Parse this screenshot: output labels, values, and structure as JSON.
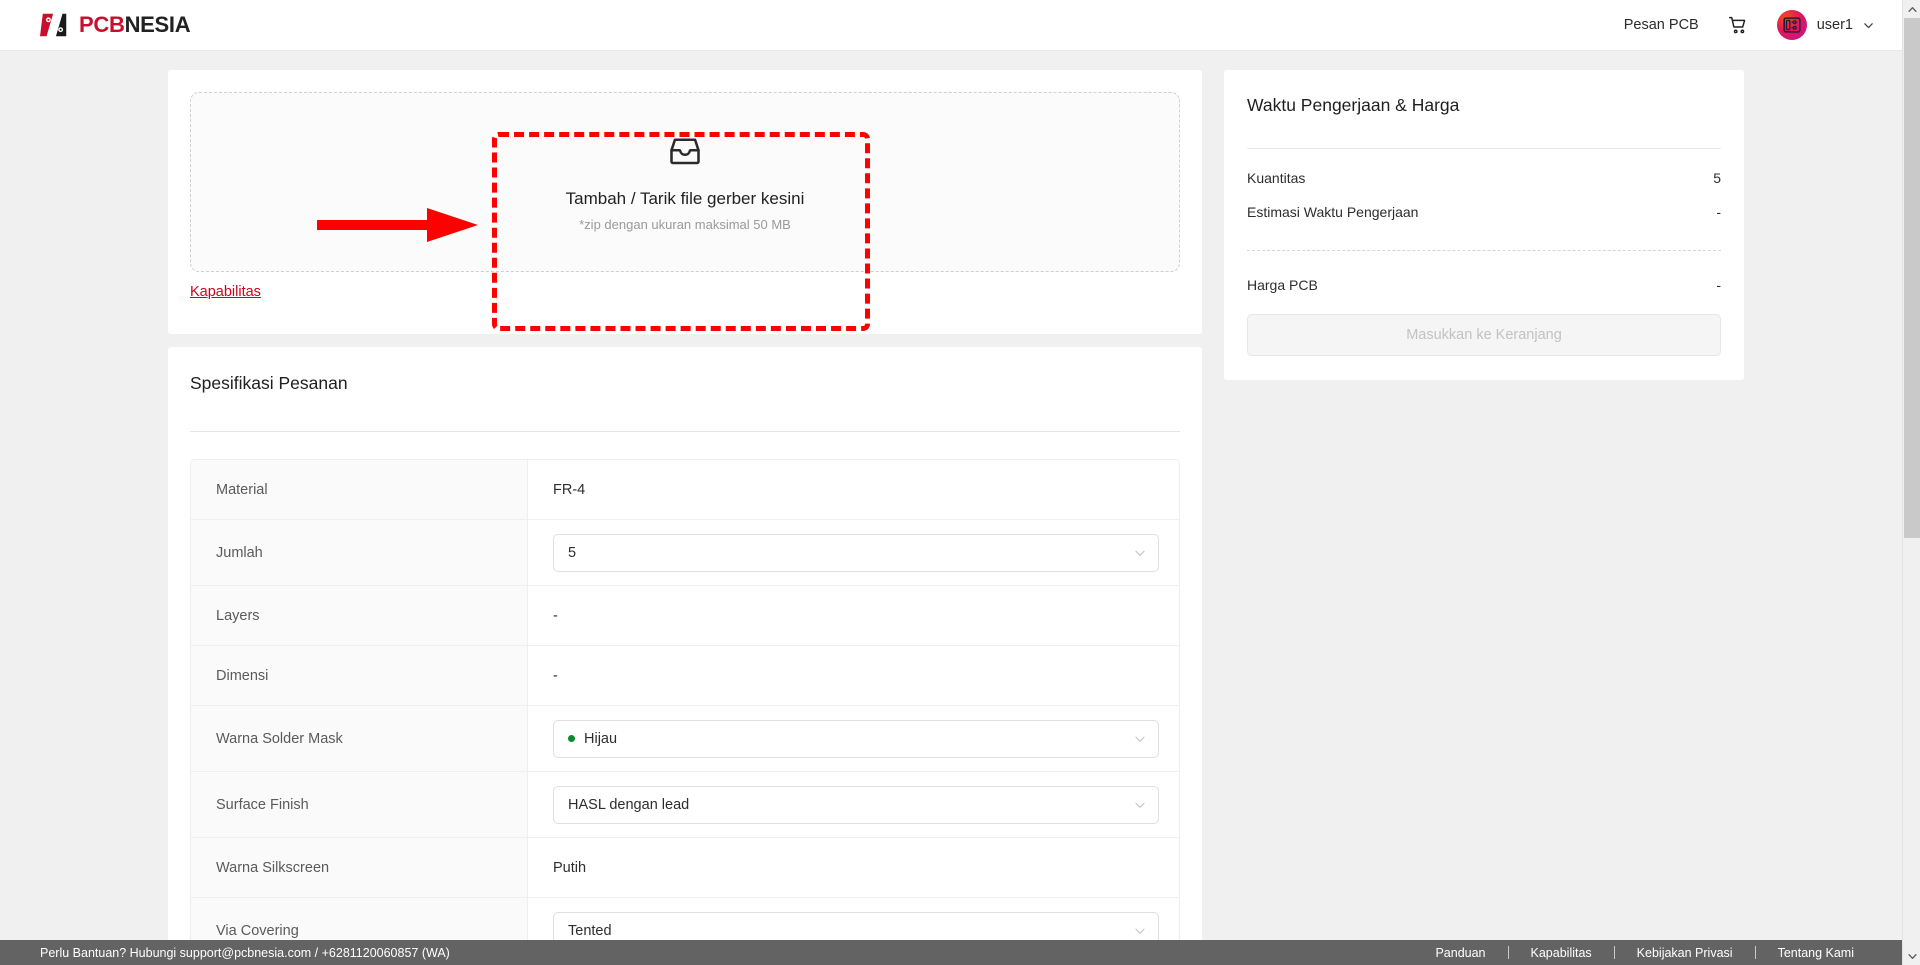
{
  "header": {
    "brand": {
      "red_part": "PCB",
      "dark_part": "NESIA",
      "logo_icon": "pcbnesia-logo-mark"
    },
    "nav_link": "Pesan PCB",
    "cart_icon": "shopping-cart-icon",
    "avatar_icon": "user-avatar-pcb-icon",
    "user_name": "user1",
    "caret_icon": "chevron-down-icon"
  },
  "upload": {
    "icon": "inbox-tray-icon",
    "title": "Tambah / Tarik file gerber kesini",
    "subtitle": "*zip dengan ukuran maksimal 50 MB",
    "kapabilitas_link": "Kapabilitas"
  },
  "spec": {
    "title": "Spesifikasi Pesanan",
    "rows": [
      {
        "label": "Material",
        "value": "FR-4",
        "type": "text"
      },
      {
        "label": "Jumlah",
        "value": "5",
        "type": "select"
      },
      {
        "label": "Layers",
        "value": "-",
        "type": "text"
      },
      {
        "label": "Dimensi",
        "value": "-",
        "type": "text"
      },
      {
        "label": "Warna Solder Mask",
        "value": "Hijau",
        "type": "select",
        "dot_color": "#0a8a2a"
      },
      {
        "label": "Surface Finish",
        "value": "HASL dengan lead",
        "type": "select"
      },
      {
        "label": "Warna Silkscreen",
        "value": "Putih",
        "type": "text"
      },
      {
        "label": "Via Covering",
        "value": "Tented",
        "type": "select"
      }
    ]
  },
  "price_panel": {
    "title": "Waktu Pengerjaan & Harga",
    "quantity_label": "Kuantitas",
    "quantity_value": "5",
    "estimate_label": "Estimasi Waktu Pengerjaan",
    "estimate_value": "-",
    "price_label": "Harga PCB",
    "price_value": "-",
    "cart_button": "Masukkan ke Keranjang"
  },
  "annotations": {
    "arrow_color": "#ff0000",
    "box_color": "#ff0000"
  },
  "footer": {
    "left_text": "Perlu Bantuan? Hubungi  support@pcbnesia.com  /  +6281120060857 (WA)",
    "links": [
      "Panduan",
      "Kapabilitas",
      "Kebijakan Privasi",
      "Tentang Kami"
    ]
  },
  "colors": {
    "brand_red": "#c8102e",
    "link_red": "#d0021b",
    "green_dot": "#0a8a2a",
    "footer_bg": "#636363"
  }
}
